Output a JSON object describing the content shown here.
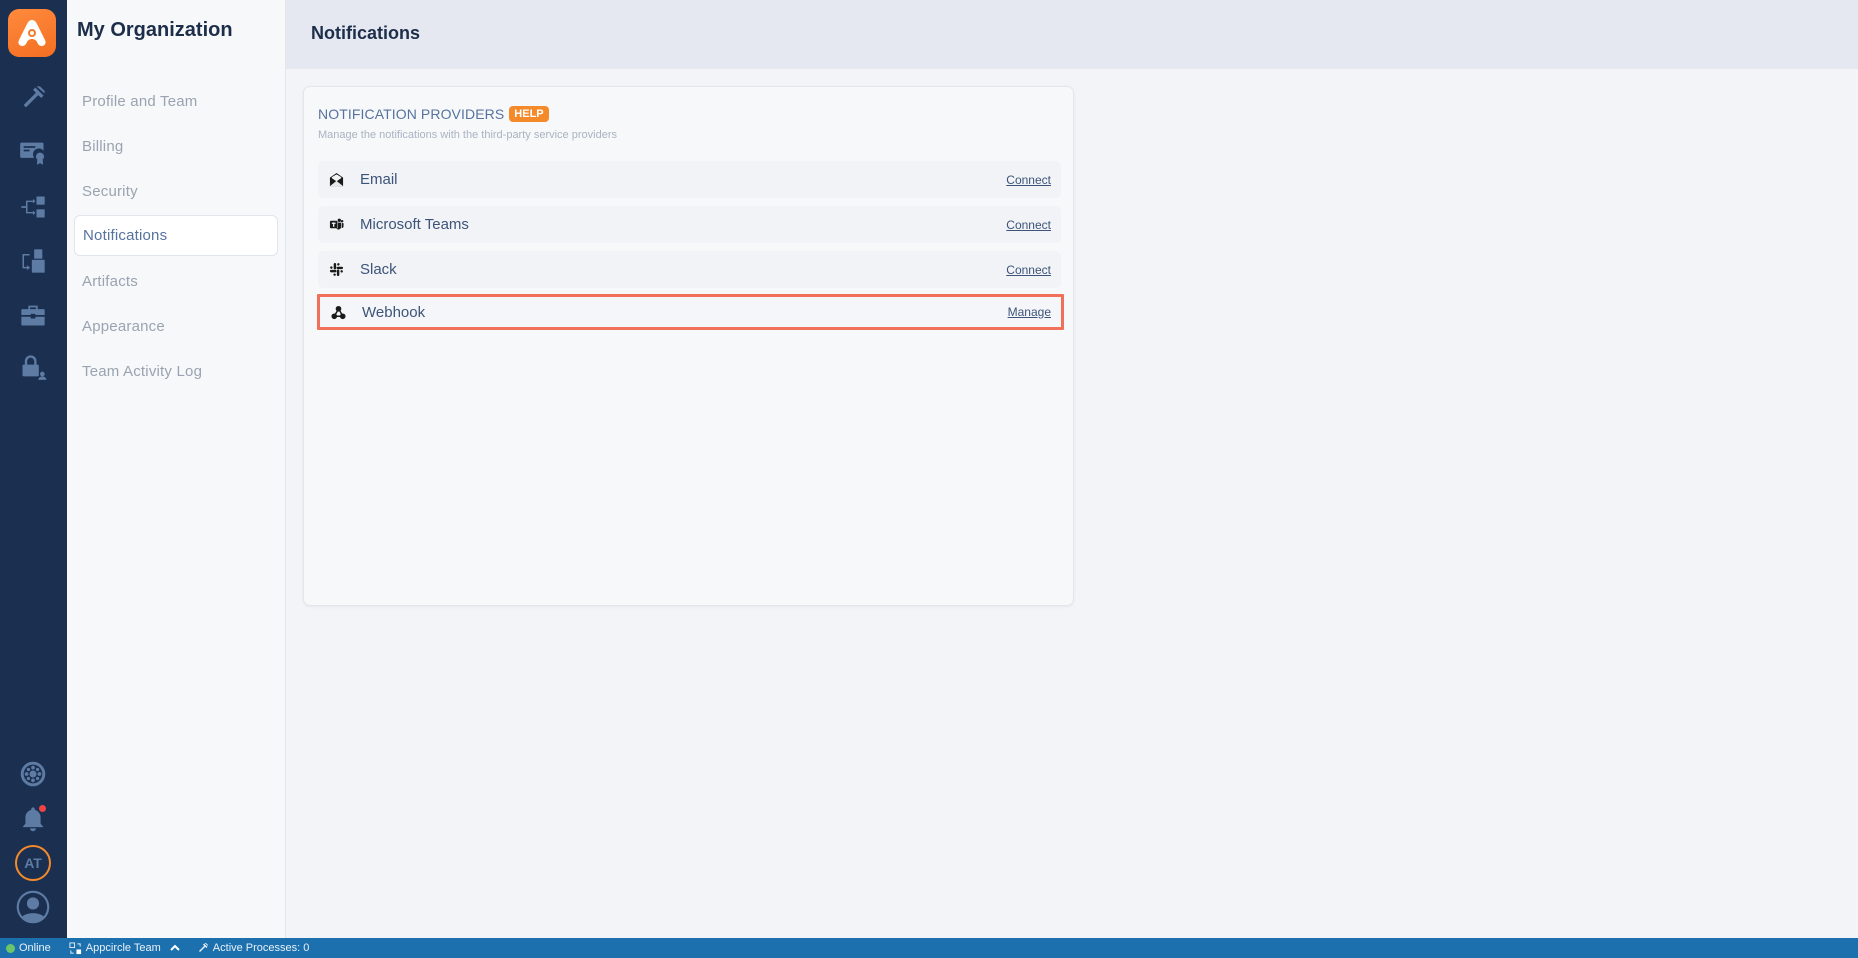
{
  "rail": {
    "logo": "appcircle-logo",
    "top_icons": [
      "hammer-icon",
      "certificate-icon",
      "branch-icon",
      "distribute-icon",
      "briefcase-icon",
      "lock-user-icon"
    ],
    "bottom_icons": [
      "wheel-icon",
      "bell-icon"
    ],
    "avatar_initials": "AT"
  },
  "subnav": {
    "title": "My Organization",
    "items": [
      {
        "label": "Profile and Team",
        "active": false
      },
      {
        "label": "Billing",
        "active": false
      },
      {
        "label": "Security",
        "active": false
      },
      {
        "label": "Notifications",
        "active": true
      },
      {
        "label": "Artifacts",
        "active": false
      },
      {
        "label": "Appearance",
        "active": false
      },
      {
        "label": "Team Activity Log",
        "active": false
      }
    ]
  },
  "main": {
    "title": "Notifications",
    "card": {
      "title": "NOTIFICATION PROVIDERS",
      "help_label": "HELP",
      "subtitle": "Manage the notifications with the third-party service providers",
      "providers": [
        {
          "name": "Email",
          "icon": "envelope-open-icon",
          "action": "Connect"
        },
        {
          "name": "Microsoft Teams",
          "icon": "teams-icon",
          "action": "Connect"
        },
        {
          "name": "Slack",
          "icon": "slack-icon",
          "action": "Connect"
        },
        {
          "name": "Webhook",
          "icon": "webhook-icon",
          "action": "Manage",
          "highlighted": true
        }
      ]
    }
  },
  "statusbar": {
    "status": "Online",
    "team": "Appcircle Team",
    "processes": "Active Processes: 0"
  },
  "colors": {
    "accent": "#f58a2b",
    "rail": "#1b3050",
    "statusbar": "#1c70ad",
    "highlight": "#f0705a"
  }
}
